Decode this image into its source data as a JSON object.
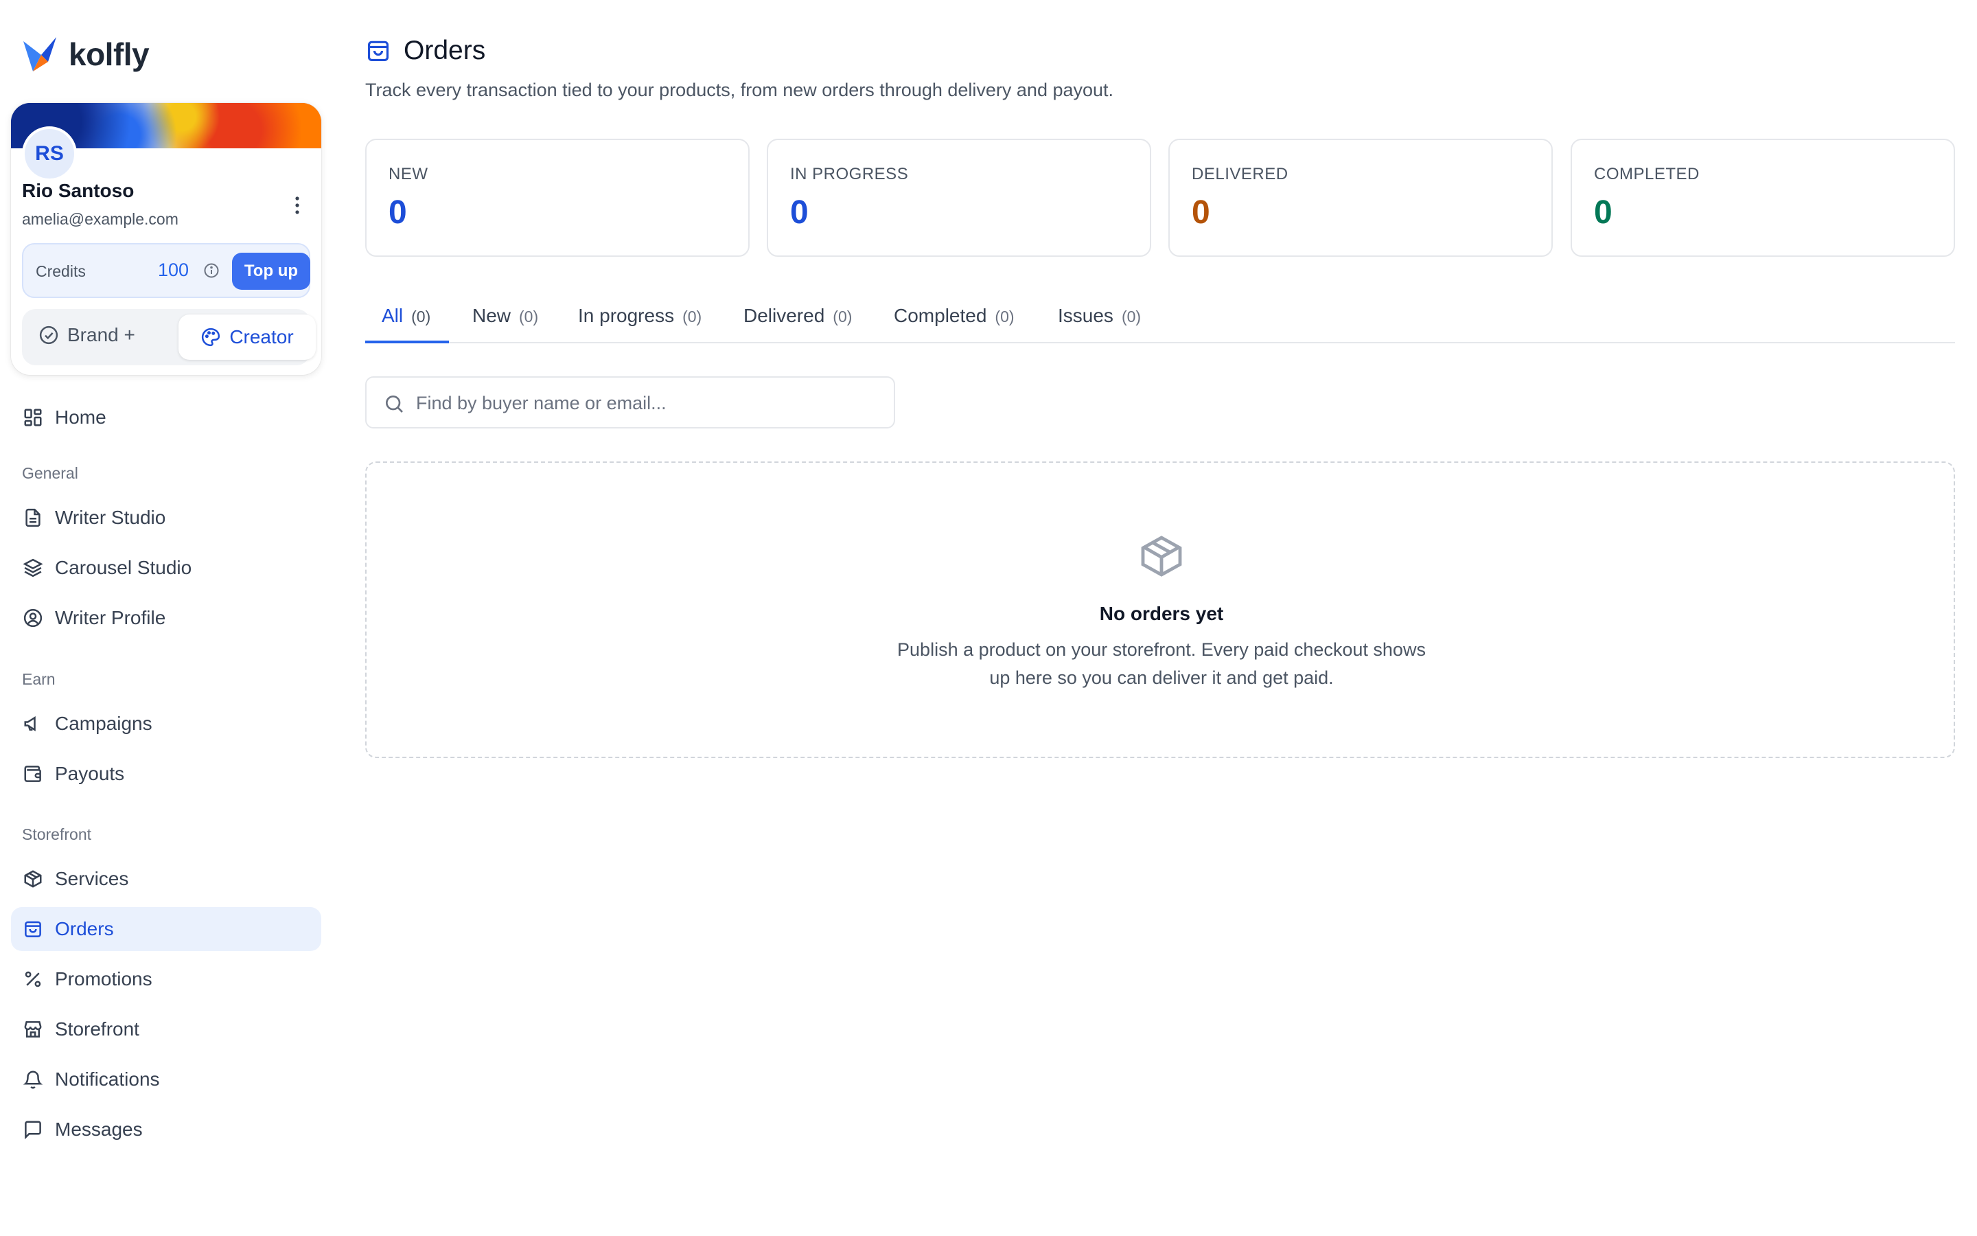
{
  "brand": {
    "name": "kolfly"
  },
  "profile": {
    "initials": "RS",
    "name": "Rio Santoso",
    "email": "amelia@example.com",
    "credits_label": "Credits",
    "credits_value": "100",
    "topup_label": "Top up",
    "mode_brand": "Brand +",
    "mode_creator": "Creator"
  },
  "nav": {
    "home": "Home",
    "sections": {
      "general": "General",
      "earn": "Earn",
      "storefront": "Storefront"
    },
    "items": {
      "writer_studio": "Writer Studio",
      "carousel_studio": "Carousel Studio",
      "writer_profile": "Writer Profile",
      "campaigns": "Campaigns",
      "payouts": "Payouts",
      "services": "Services",
      "orders": "Orders",
      "promotions": "Promotions",
      "storefront": "Storefront",
      "notifications": "Notifications",
      "messages": "Messages"
    }
  },
  "page": {
    "title": "Orders",
    "subtitle": "Track every transaction tied to your products, from new orders through delivery and payout."
  },
  "stats": [
    {
      "label": "NEW",
      "value": "0",
      "color": "#1d4ed8"
    },
    {
      "label": "IN PROGRESS",
      "value": "0",
      "color": "#1d4ed8"
    },
    {
      "label": "DELIVERED",
      "value": "0",
      "color": "#b45309"
    },
    {
      "label": "COMPLETED",
      "value": "0",
      "color": "#047857"
    }
  ],
  "tabs": [
    {
      "label": "All",
      "count": "(0)"
    },
    {
      "label": "New",
      "count": "(0)"
    },
    {
      "label": "In progress",
      "count": "(0)"
    },
    {
      "label": "Delivered",
      "count": "(0)"
    },
    {
      "label": "Completed",
      "count": "(0)"
    },
    {
      "label": "Issues",
      "count": "(0)"
    }
  ],
  "search": {
    "placeholder": "Find by buyer name or email...",
    "value": ""
  },
  "empty_state": {
    "icon": "package-icon",
    "title": "No orders yet",
    "text": "Publish a product on your storefront. Every paid checkout shows up here so you can deliver it and get paid."
  },
  "colors": {
    "accent": "#2563eb",
    "topup": "#3b6ff0",
    "active_bg": "#eaf1fd"
  }
}
